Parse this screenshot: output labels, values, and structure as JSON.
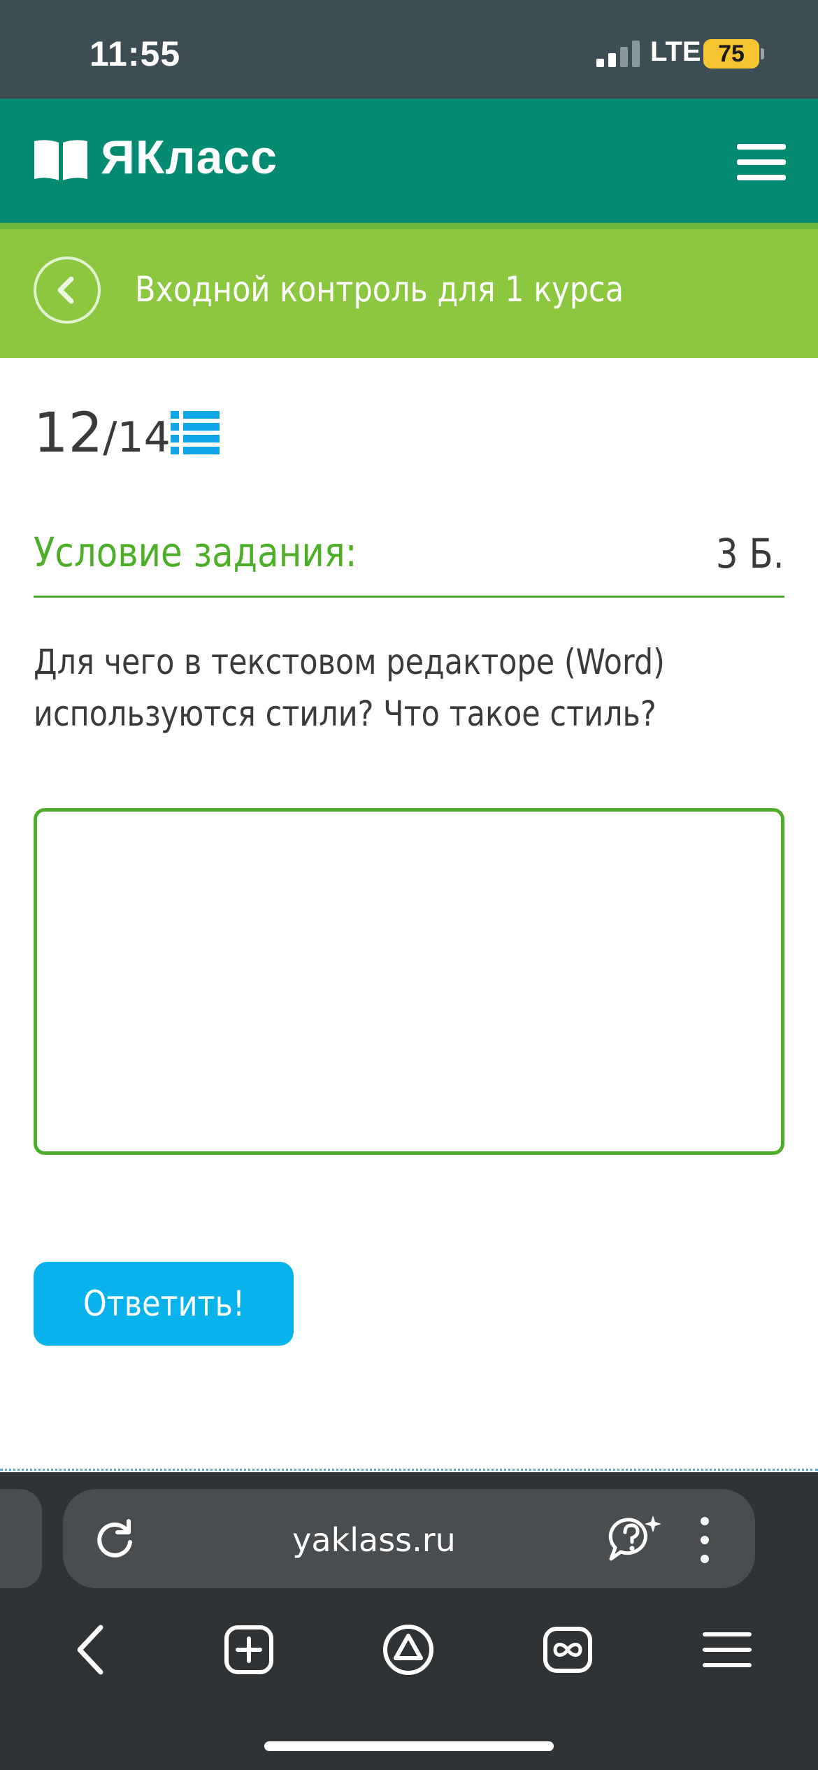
{
  "status_bar": {
    "time": "11:55",
    "network": "LTE",
    "battery": "75"
  },
  "header": {
    "brand": "ЯКласс"
  },
  "breadcrumb": {
    "title": "Входной контроль для 1 курса"
  },
  "progress": {
    "current": "12",
    "total": "/14"
  },
  "task": {
    "heading": "Условие задания:",
    "points": "3 Б.",
    "question": "Для чего в текстовом редакторе (Word) используются стили? Что такое стиль?",
    "answer_value": ""
  },
  "actions": {
    "submit_label": "Ответить!"
  },
  "browser": {
    "url": "yaklass.ru"
  },
  "colors": {
    "status_bar": "#3d4d54",
    "header": "#058a72",
    "breadcrumb": "#8dc63f",
    "accent_green": "#4caf27",
    "button_blue": "#08b2ea",
    "browser_bar": "#2f3335"
  },
  "icons": [
    "signal-icon",
    "battery-icon",
    "book-logo-icon",
    "hamburger-menu-icon",
    "back-chevron-icon",
    "task-list-icon",
    "reload-icon",
    "assistant-icon",
    "more-vertical-icon",
    "back-arrow-icon",
    "new-tab-icon",
    "alice-icon",
    "tabs-icon",
    "menu-icon"
  ]
}
